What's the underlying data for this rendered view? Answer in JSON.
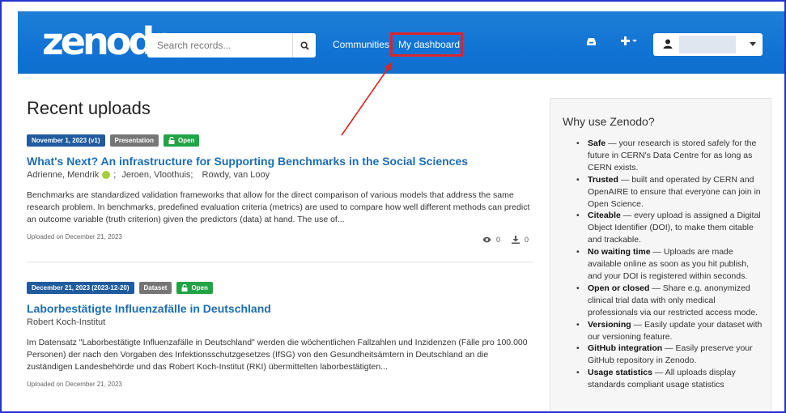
{
  "header": {
    "logo": "zenodo",
    "search_placeholder": "Search records...",
    "nav_communities": "Communities",
    "nav_dashboard": "My dashboard",
    "colors": {
      "bar": "#1173d4",
      "highlight": "#d9262e"
    }
  },
  "main": {
    "title": "Recent uploads",
    "records": [
      {
        "date_badge": "November 1, 2023 (v1)",
        "type_badge": "Presentation",
        "access_badge": "Open",
        "title": "What's Next? An infrastructure for Supporting Benchmarks in the Social Sciences",
        "authors": [
          "Adrienne, Mendrik",
          "Jeroen, Vloothuis;",
          "Rowdy, van Looy"
        ],
        "description": "Benchmarks are standardized validation frameworks that allow for the direct comparison of various models that address the same research problem. In benchmarks, predefined evaluation criteria (metrics) are used to compare how well different methods can predict an outcome variable (truth criterion) given the predictors (data) at hand. The use of...",
        "uploaded": "Uploaded on December 21, 2023",
        "views": "0",
        "downloads": "0"
      },
      {
        "date_badge": "December 21, 2023 (2023-12-20)",
        "type_badge": "Dataset",
        "access_badge": "Open",
        "title": "Laborbestätigte Influenzafälle in Deutschland",
        "authors": [
          "Robert Koch-Institut"
        ],
        "description": "Im Datensatz \"Laborbestätigte Influenzafälle in Deutschland\" werden die wöchentlichen Fallzahlen und Inzidenzen (Fälle pro 100.000 Personen) der nach den Vorgaben des Infektionsschutzgesetzes (IfSG) von den Gesundheitsämtern in Deutschland an die zuständigen Landesbehörde und das Robert Koch-Institut (RKI) übermittelten laborbestätigten...",
        "uploaded": "Uploaded on December 21, 2023"
      }
    ]
  },
  "sidebar": {
    "title": "Why use Zenodo?",
    "items": [
      {
        "term": "Safe",
        "text": " — your research is stored safely for the future in CERN's Data Centre for as long as CERN exists."
      },
      {
        "term": "Trusted",
        "text": " — built and operated by CERN and OpenAIRE to ensure that everyone can join in Open Science."
      },
      {
        "term": "Citeable",
        "text": " — every upload is assigned a Digital Object Identifier (DOI), to make them citable and trackable."
      },
      {
        "term": "No waiting time",
        "text": " — Uploads are made available online as soon as you hit publish, and your DOI is registered within seconds."
      },
      {
        "term": "Open or closed",
        "text": " — Share e.g. anonymized clinical trial data with only medical professionals via our restricted access mode."
      },
      {
        "term": "Versioning",
        "text": " — Easily update your dataset with our versioning feature."
      },
      {
        "term": "GitHub integration",
        "text": " — Easily preserve your GitHub repository in Zenodo."
      },
      {
        "term": "Usage statistics",
        "text": " — All uploads display standards compliant usage statistics"
      }
    ]
  }
}
